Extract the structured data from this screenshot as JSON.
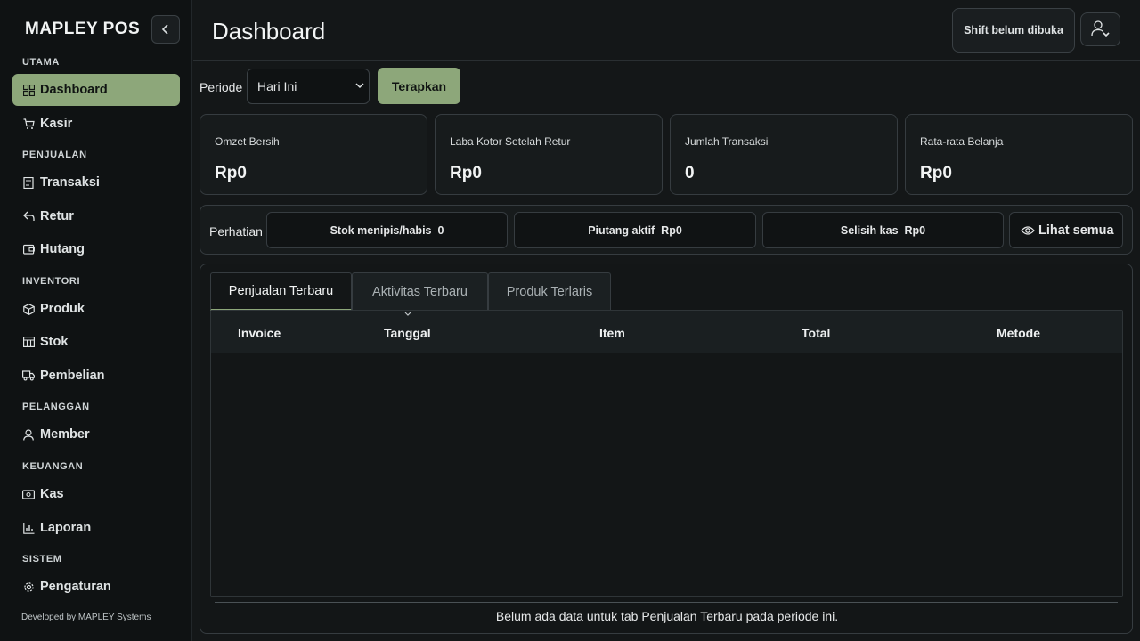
{
  "sidebar": {
    "brand": "MAPLEY POS",
    "sections": {
      "utama": "UTAMA",
      "penjualan": "PENJUALAN",
      "inventori": "INVENTORI",
      "pelanggan": "PELANGGAN",
      "keuangan": "KEUANGAN",
      "sistem": "SISTEM"
    },
    "items": {
      "dashboard": "Dashboard",
      "kasir": "Kasir",
      "transaksi": "Transaksi",
      "retur": "Retur",
      "hutang": "Hutang",
      "produk": "Produk",
      "stok": "Stok",
      "pembelian": "Pembelian",
      "member": "Member",
      "kas": "Kas",
      "laporan": "Laporan",
      "pengaturan": "Pengaturan"
    },
    "credit": "Developed by MAPLEY Systems",
    "accent": "#8da77a"
  },
  "header": {
    "title": "Dashboard",
    "shift_status": "Shift belum dibuka"
  },
  "filter": {
    "label": "Periode",
    "selected": "Hari Ini",
    "apply": "Terapkan"
  },
  "stats": [
    {
      "label": "Omzet Bersih",
      "value": "Rp0"
    },
    {
      "label": "Laba Kotor Setelah Retur",
      "value": "Rp0"
    },
    {
      "label": "Jumlah Transaksi",
      "value": "0"
    },
    {
      "label": "Rata-rata Belanja",
      "value": "Rp0"
    }
  ],
  "alerts": {
    "label": "Perhatian",
    "low_stock": {
      "label": "Stok menipis/habis",
      "value": "0"
    },
    "receivable": {
      "label": "Piutang aktif",
      "value": "Rp0"
    },
    "cash_diff": {
      "label": "Selisih kas",
      "value": "Rp0"
    },
    "see_all": "Lihat semua"
  },
  "tabs": [
    "Penjualan Terbaru",
    "Aktivitas Terbaru",
    "Produk Terlaris"
  ],
  "table": {
    "columns": [
      "Invoice",
      "Tanggal",
      "Item",
      "Total",
      "Metode"
    ],
    "empty_message": "Belum ada data untuk tab Penjualan Terbaru pada periode ini."
  }
}
